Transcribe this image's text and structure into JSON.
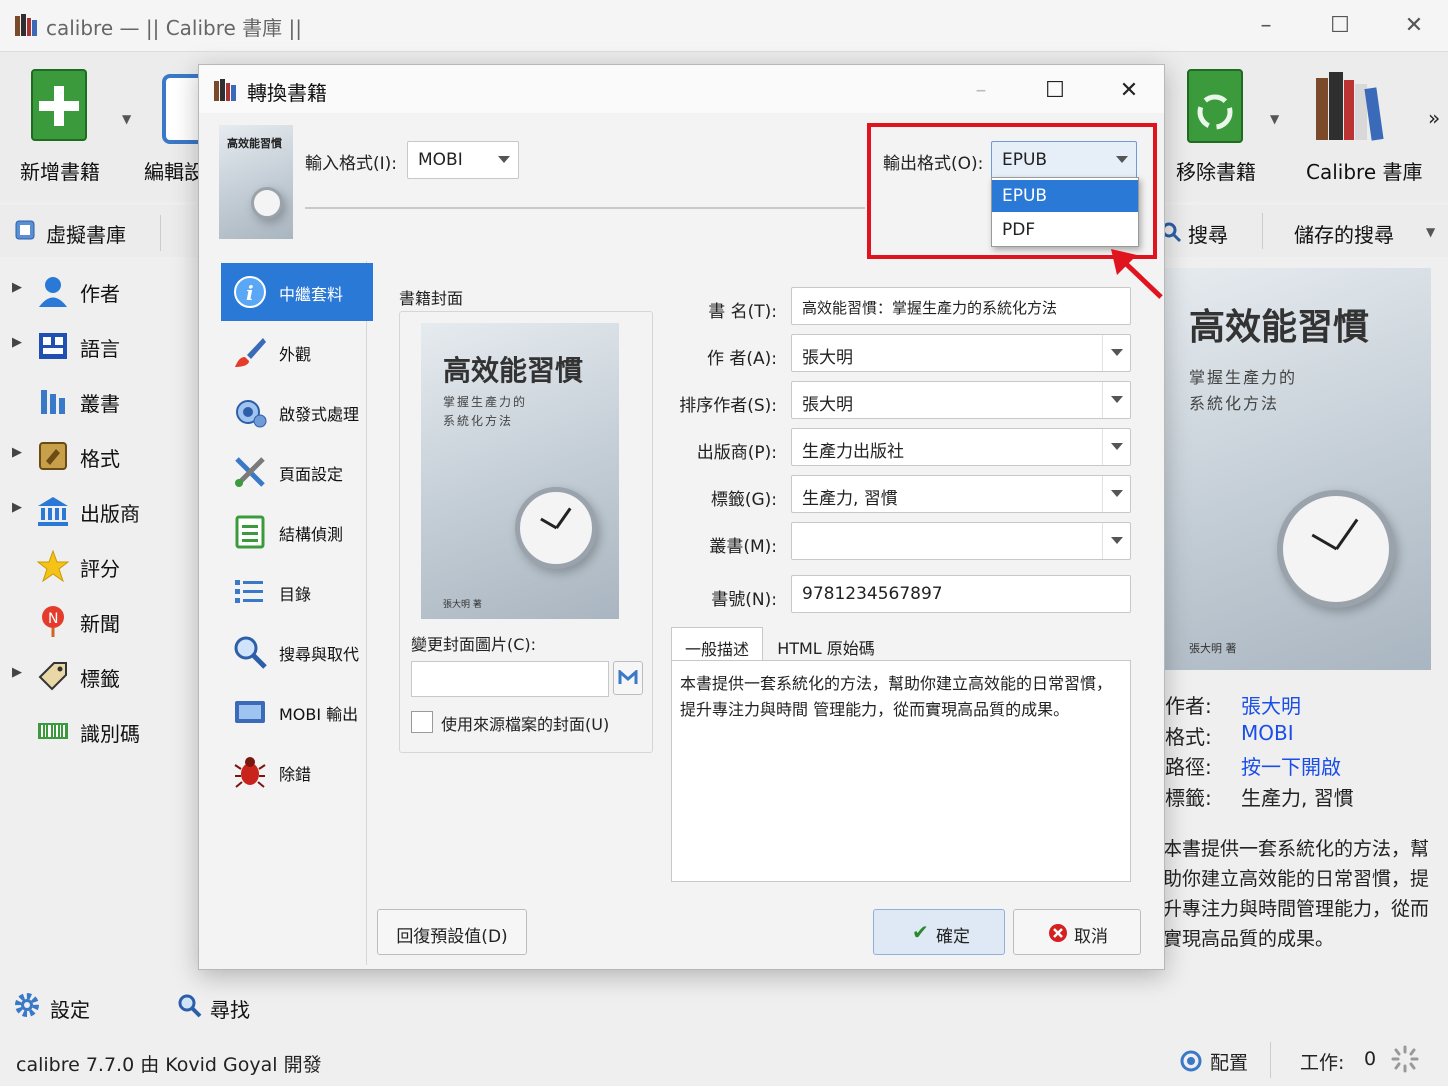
{
  "app": {
    "title": "calibre — || Calibre 書庫 ||",
    "toolbar": {
      "add_books": "新增書籍",
      "edit_metadata": "編輯設",
      "remove_books": "移除書籍",
      "calibre_library": "Calibre 書庫",
      "more": "»"
    },
    "searchbar": {
      "virtual_library": "虛擬書庫",
      "search": "搜尋",
      "saved_searches": "儲存的搜尋"
    },
    "tag_browser": [
      {
        "label": "作者",
        "icon": "person-icon",
        "expandable": true
      },
      {
        "label": "語言",
        "icon": "language-icon",
        "expandable": true
      },
      {
        "label": "叢書",
        "icon": "series-icon",
        "expandable": false
      },
      {
        "label": "格式",
        "icon": "format-icon",
        "expandable": true
      },
      {
        "label": "出版商",
        "icon": "publisher-icon",
        "expandable": true
      },
      {
        "label": "評分",
        "icon": "star-icon",
        "expandable": false
      },
      {
        "label": "新聞",
        "icon": "news-icon",
        "expandable": false
      },
      {
        "label": "標籤",
        "icon": "tag-icon",
        "expandable": true
      },
      {
        "label": "識別碼",
        "icon": "barcode-icon",
        "expandable": false
      }
    ],
    "book_details": {
      "cover_title": "高效能習慣",
      "cover_subtitle_1": "掌握生產力的",
      "cover_subtitle_2": "系統化方法",
      "cover_author": "張大明 著",
      "author_label": "作者:",
      "author_value": "張大明",
      "format_label": "格式:",
      "format_value": "MOBI",
      "path_label": "路徑:",
      "path_value": "按一下開啟",
      "tags_label": "標籤:",
      "tags_value": "生產力, 習慣",
      "description": "本書提供一套系統化的方法，幫助你建立高效能的日常習慣，提升專注力與時間管理能力，從而實現高品質的成果。"
    },
    "status": {
      "settings": "設定",
      "find": "尋找",
      "version": "calibre 7.7.0 由 Kovid Goyal 開發",
      "layout": "配置",
      "jobs_label": "工作:",
      "jobs_count": "0"
    }
  },
  "dialog": {
    "title": "轉換書籍",
    "input_format_label": "輸入格式(I):",
    "input_format_value": "MOBI",
    "output_format_label": "輸出格式(O):",
    "output_format_value": "EPUB",
    "output_options": [
      "EPUB",
      "PDF"
    ],
    "highlight_color": "#e0141e",
    "sidebar": [
      {
        "label": "中繼套料",
        "icon": "info-icon",
        "active": true
      },
      {
        "label": "外觀",
        "icon": "brush-icon",
        "active": false
      },
      {
        "label": "啟發式處理",
        "icon": "heuristics-icon",
        "active": false
      },
      {
        "label": "頁面設定",
        "icon": "page-setup-icon",
        "active": false
      },
      {
        "label": "結構偵測",
        "icon": "structure-icon",
        "active": false
      },
      {
        "label": "目錄",
        "icon": "toc-icon",
        "active": false
      },
      {
        "label": "搜尋與取代",
        "icon": "search-replace-icon",
        "active": false
      },
      {
        "label": "MOBI 輸出",
        "icon": "mobi-output-icon",
        "active": false
      },
      {
        "label": "除錯",
        "icon": "bug-icon",
        "active": false
      }
    ],
    "cover_group_label": "書籍封面",
    "change_cover_label": "變更封面圖片(C):",
    "use_source_cover_label": "使用來源檔案的封面(U)",
    "fields": {
      "title_label": "書 名(T):",
      "title_value": "高效能習慣：掌握生產力的系統化方法",
      "author_label": "作 者(A):",
      "author_value": "張大明",
      "sort_label": "排序作者(S):",
      "sort_value": "張大明",
      "publisher_label": "出版商(P):",
      "publisher_value": "生產力出版社",
      "tags_label": "標籤(G):",
      "tags_value": "生產力, 習慣",
      "series_label": "叢書(M):",
      "series_value": "",
      "isbn_label": "書號(N):",
      "isbn_value": "9781234567897"
    },
    "tabs": [
      "一般描述",
      "HTML 原始碼"
    ],
    "description": "本書提供一套系統化的方法，幫助你建立高效能的日常習慣，提升專注力與時間 管理能力，從而實現高品質的成果。",
    "restore_defaults": "回復預設值(D)",
    "ok": "確定",
    "cancel": "取消"
  }
}
